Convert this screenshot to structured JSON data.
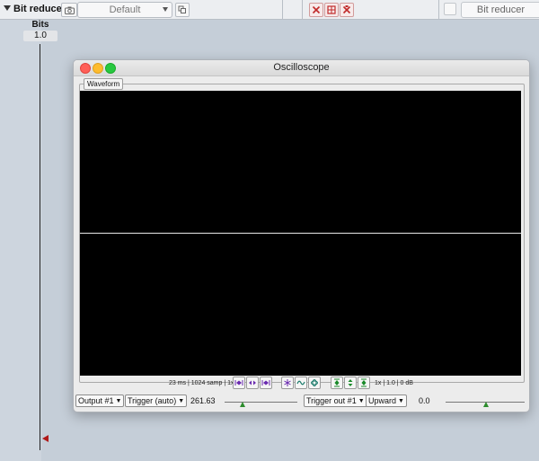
{
  "toolbar": {
    "plugin_name": "Bit reducer",
    "preset": "Default",
    "bypass_label": "Bit reducer"
  },
  "parameter": {
    "name": "Bits",
    "value": "1.0"
  },
  "oscilloscope": {
    "window_title": "Oscilloscope",
    "tab_label": "Waveform",
    "info_left": "23 ms | 1024 samp | 1x",
    "info_right": "1x | 1.0 | 0 dB",
    "output_select": "Output #1",
    "trigger_mode": "Trigger (auto)",
    "trigger_freq": "261.63",
    "trigger_out": "Trigger out #1",
    "trigger_direction": "Upward",
    "trigger_level": "0.0"
  },
  "colors": {
    "scope_background": "#000000",
    "trace": "#e8e8e8",
    "slider_knob": "#2d8c2d",
    "marker": "#b01818"
  }
}
